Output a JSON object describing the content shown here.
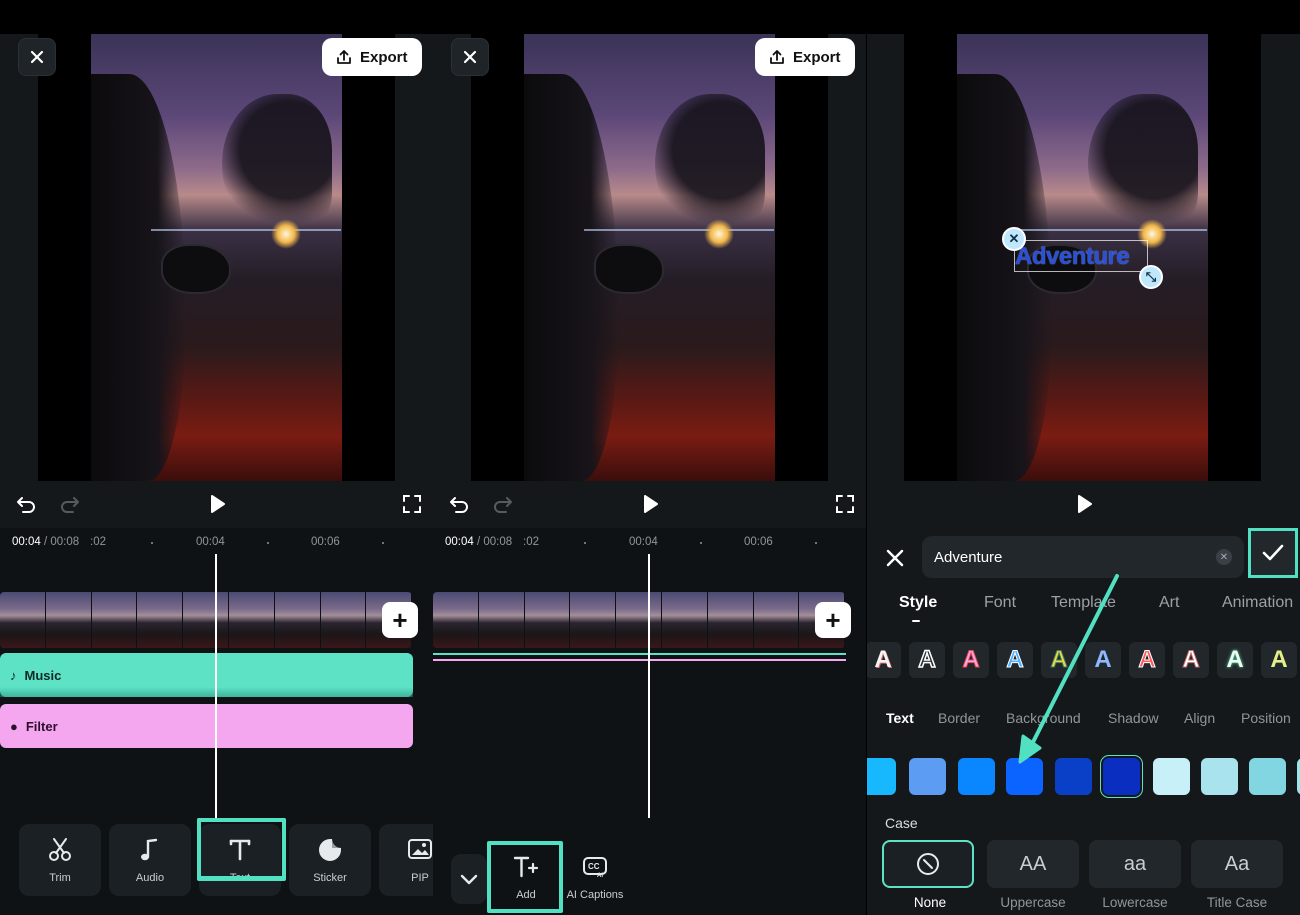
{
  "panel1": {
    "export_label": "Export",
    "timecode_current": "00:04",
    "timecode_total": " / 00:08",
    "ticks": [
      ":02",
      "00:04",
      "00:06"
    ],
    "tracks": {
      "music": "Music",
      "filter": "Filter"
    },
    "tools": [
      "Trim",
      "Audio",
      "Text",
      "Sticker",
      "PIP"
    ]
  },
  "panel2": {
    "export_label": "Export",
    "timecode_current": "00:04",
    "timecode_total": " / 00:08",
    "ticks": [
      ":02",
      "00:04",
      "00:06"
    ],
    "tools": [
      "Add",
      "AI Captions"
    ]
  },
  "panel3": {
    "overlay_text": "Adventure",
    "input_value": "Adventure",
    "tabs": [
      "Style",
      "Font",
      "Template",
      "Art",
      "Animation"
    ],
    "active_tab": "Style",
    "subtabs": [
      "Text",
      "Border",
      "Background",
      "Shadow",
      "Align",
      "Position"
    ],
    "active_subtab": "Text",
    "case_label": "Case",
    "case_options": [
      {
        "glyph": "",
        "caption": "None"
      },
      {
        "glyph": "AA",
        "caption": "Uppercase"
      },
      {
        "glyph": "aa",
        "caption": "Lowercase"
      },
      {
        "glyph": "Aa",
        "caption": "Title Case"
      }
    ],
    "style_glyph": "A",
    "swatch_colors": [
      "#18b8ff",
      "#5c9cf2",
      "#0a86ff",
      "#0b64ff",
      "#0a40c8",
      "#0a2fc0",
      "#c8f0f8",
      "#a9e4ee",
      "#82d6e2",
      "#9ee6ee"
    ]
  },
  "colors": {
    "accent": "#51e0c2",
    "music": "#5de2c5",
    "filter": "#f4a6ef"
  }
}
